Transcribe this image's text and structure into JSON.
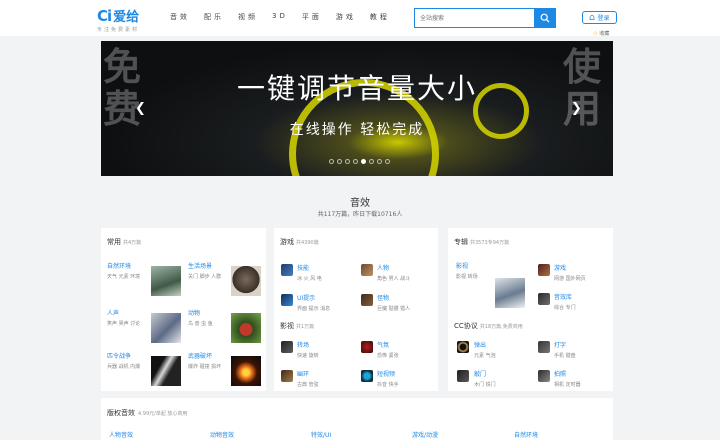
{
  "header": {
    "logo_mark": "Ci",
    "logo_text": "爱给",
    "slogan": "专注免费素材",
    "nav": [
      "音效",
      "配乐",
      "视频",
      "3D",
      "平面",
      "游戏",
      "教程"
    ],
    "search_placeholder": "全站搜索",
    "login_label": "登录",
    "favorite_label": "收藏"
  },
  "banner": {
    "title": "一键调节音量大小",
    "subtitle": "在线操作  轻松完成",
    "left_chars": "免\n费",
    "right_chars": "使\n用",
    "slide_count": 8,
    "active_slide": 4
  },
  "section": {
    "title": "音效",
    "summary": "共117万篇，昨日下载10716人"
  },
  "cards": {
    "common": {
      "head": "常用",
      "count": "共4万篇",
      "items": [
        {
          "name": "自然环境",
          "tags": "天气 元素 环境"
        },
        {
          "name": "生活场景",
          "tags": "关门 脚步 人群"
        },
        {
          "name": "人声",
          "tags": "笑声 哭声 讨论"
        },
        {
          "name": "动物",
          "tags": "鸟 兽 虫 鱼"
        },
        {
          "name": "匹令战争",
          "tags": "兵器 战机 内爆"
        },
        {
          "name": "武器破坏",
          "tags": "爆炸 碰撞 损坏"
        }
      ]
    },
    "game": {
      "head": "游戏",
      "count": "共4390篇",
      "items": [
        {
          "name": "技能",
          "tags": "冰 火 风 电"
        },
        {
          "name": "人物",
          "tags": "角色 男人 战斗"
        },
        {
          "name": "UI提示",
          "tags": "界面 提示 消息"
        },
        {
          "name": "怪物",
          "tags": "巨魔 骷髅 猎人"
        }
      ],
      "sub_head": "影视",
      "sub_count": "共1万篇",
      "sub_items": [
        {
          "name": "转场",
          "tags": "快速 旋转"
        },
        {
          "name": "气氛",
          "tags": "恐怖 紧张"
        },
        {
          "name": "幽环",
          "tags": "古典 管弦"
        },
        {
          "name": "短视频",
          "tags": "抖音 快手"
        }
      ]
    },
    "special": {
      "head": "专辑",
      "count": "共3573专94万篇",
      "items": [
        {
          "name": "影视",
          "tags": "影视 转场"
        },
        {
          "name": "游戏",
          "tags": "网游 国外网页"
        },
        {
          "name": "音效库",
          "tags": "综合 专门"
        }
      ],
      "sub_head": "CC协议",
      "sub_count": "共18万篇,免费商用",
      "sub_items": [
        {
          "name": "弹出",
          "tags": "元素 气泡"
        },
        {
          "name": "打字",
          "tags": "手机 键盘"
        },
        {
          "name": "敲门",
          "tags": "木门 铁门"
        },
        {
          "name": "拍照",
          "tags": "相机 定时器"
        }
      ]
    }
  },
  "bottom": {
    "head": "版权音效",
    "count": "4.99元/单起 放心商用",
    "cats": [
      "人物音效",
      "动物音效",
      "特效/UI",
      "游戏/动漫",
      "自然环境"
    ]
  },
  "colors": {
    "accent": "#1e88e5",
    "banner_yellow": "#d6d600"
  }
}
